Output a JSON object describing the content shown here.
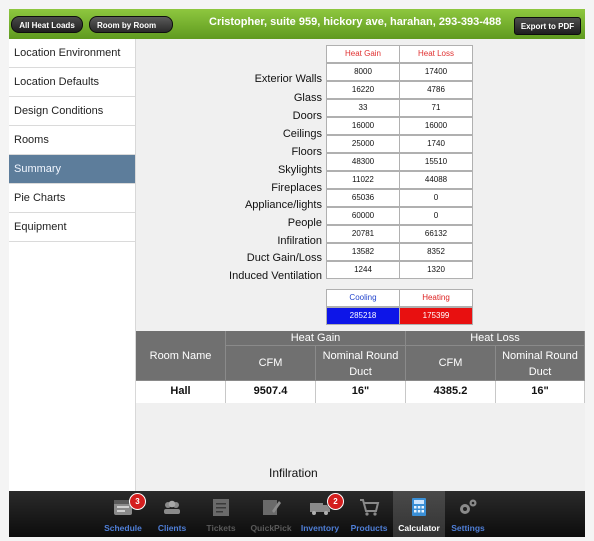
{
  "toolbar": {
    "all_heat_loads": "All Heat Loads",
    "room_by_room": "Room by Room",
    "title": "Cristopher, suite 959, hickory ave, harahan, 293-393-488",
    "export_pdf": "Export to PDF"
  },
  "sidebar": {
    "items": [
      {
        "label": "Location Environment"
      },
      {
        "label": "Location Defaults"
      },
      {
        "label": "Design Conditions"
      },
      {
        "label": "Rooms"
      },
      {
        "label": "Summary"
      },
      {
        "label": "Pie Charts"
      },
      {
        "label": "Equipment"
      }
    ],
    "active_index": 4
  },
  "summary": {
    "headers": {
      "gain": "Heat Gain",
      "loss": "Heat Loss"
    },
    "rows": [
      {
        "label": "Exterior Walls",
        "gain": "8000",
        "loss": "17400"
      },
      {
        "label": "Glass",
        "gain": "16220",
        "loss": "4786"
      },
      {
        "label": "Doors",
        "gain": "33",
        "loss": "71"
      },
      {
        "label": "Ceilings",
        "gain": "16000",
        "loss": "16000"
      },
      {
        "label": "Floors",
        "gain": "25000",
        "loss": "1740"
      },
      {
        "label": "Skylights",
        "gain": "48300",
        "loss": "15510"
      },
      {
        "label": "Fireplaces",
        "gain": "11022",
        "loss": "44088"
      },
      {
        "label": "Appliance/lights",
        "gain": "65036",
        "loss": "0"
      },
      {
        "label": "People",
        "gain": "60000",
        "loss": "0"
      },
      {
        "label": "Infilration",
        "gain": "20781",
        "loss": "66132"
      },
      {
        "label": "Duct Gain/Loss",
        "gain": "13582",
        "loss": "8352"
      },
      {
        "label": "Induced Ventilation",
        "gain": "1244",
        "loss": "1320"
      }
    ],
    "totals": {
      "cooling_label": "Cooling",
      "heating_label": "Heating",
      "cooling_value": "285218",
      "heating_value": "175399"
    }
  },
  "room_table": {
    "room_name_header": "Room Name",
    "heat_gain_header": "Heat Gain",
    "heat_loss_header": "Heat Loss",
    "cfm_header": "CFM",
    "duct_header": "Nominal Round Duct",
    "rows": [
      {
        "room": "Hall",
        "gain_cfm": "9507.4",
        "gain_duct": "16\"",
        "loss_cfm": "4385.2",
        "loss_duct": "16\""
      }
    ]
  },
  "footer_label": "Infilration",
  "tabbar": {
    "tabs": [
      {
        "label": "Schedule",
        "icon": "schedule-icon",
        "badge": "3"
      },
      {
        "label": "Clients",
        "icon": "clients-icon"
      },
      {
        "label": "Tickets",
        "icon": "tickets-icon"
      },
      {
        "label": "QuickPick",
        "icon": "quickpick-icon"
      },
      {
        "label": "Inventory",
        "icon": "inventory-icon",
        "badge": "2"
      },
      {
        "label": "Products",
        "icon": "products-icon"
      },
      {
        "label": "Calculator",
        "icon": "calculator-icon"
      },
      {
        "label": "Settings",
        "icon": "settings-icon"
      }
    ],
    "active": "Calculator"
  },
  "colors": {
    "accent_green": "#6fae2b",
    "sidebar_active": "#5d7d9b",
    "cooling": "#0d15e8",
    "heating": "#e81010",
    "tab_label": "#4f7fd8"
  }
}
